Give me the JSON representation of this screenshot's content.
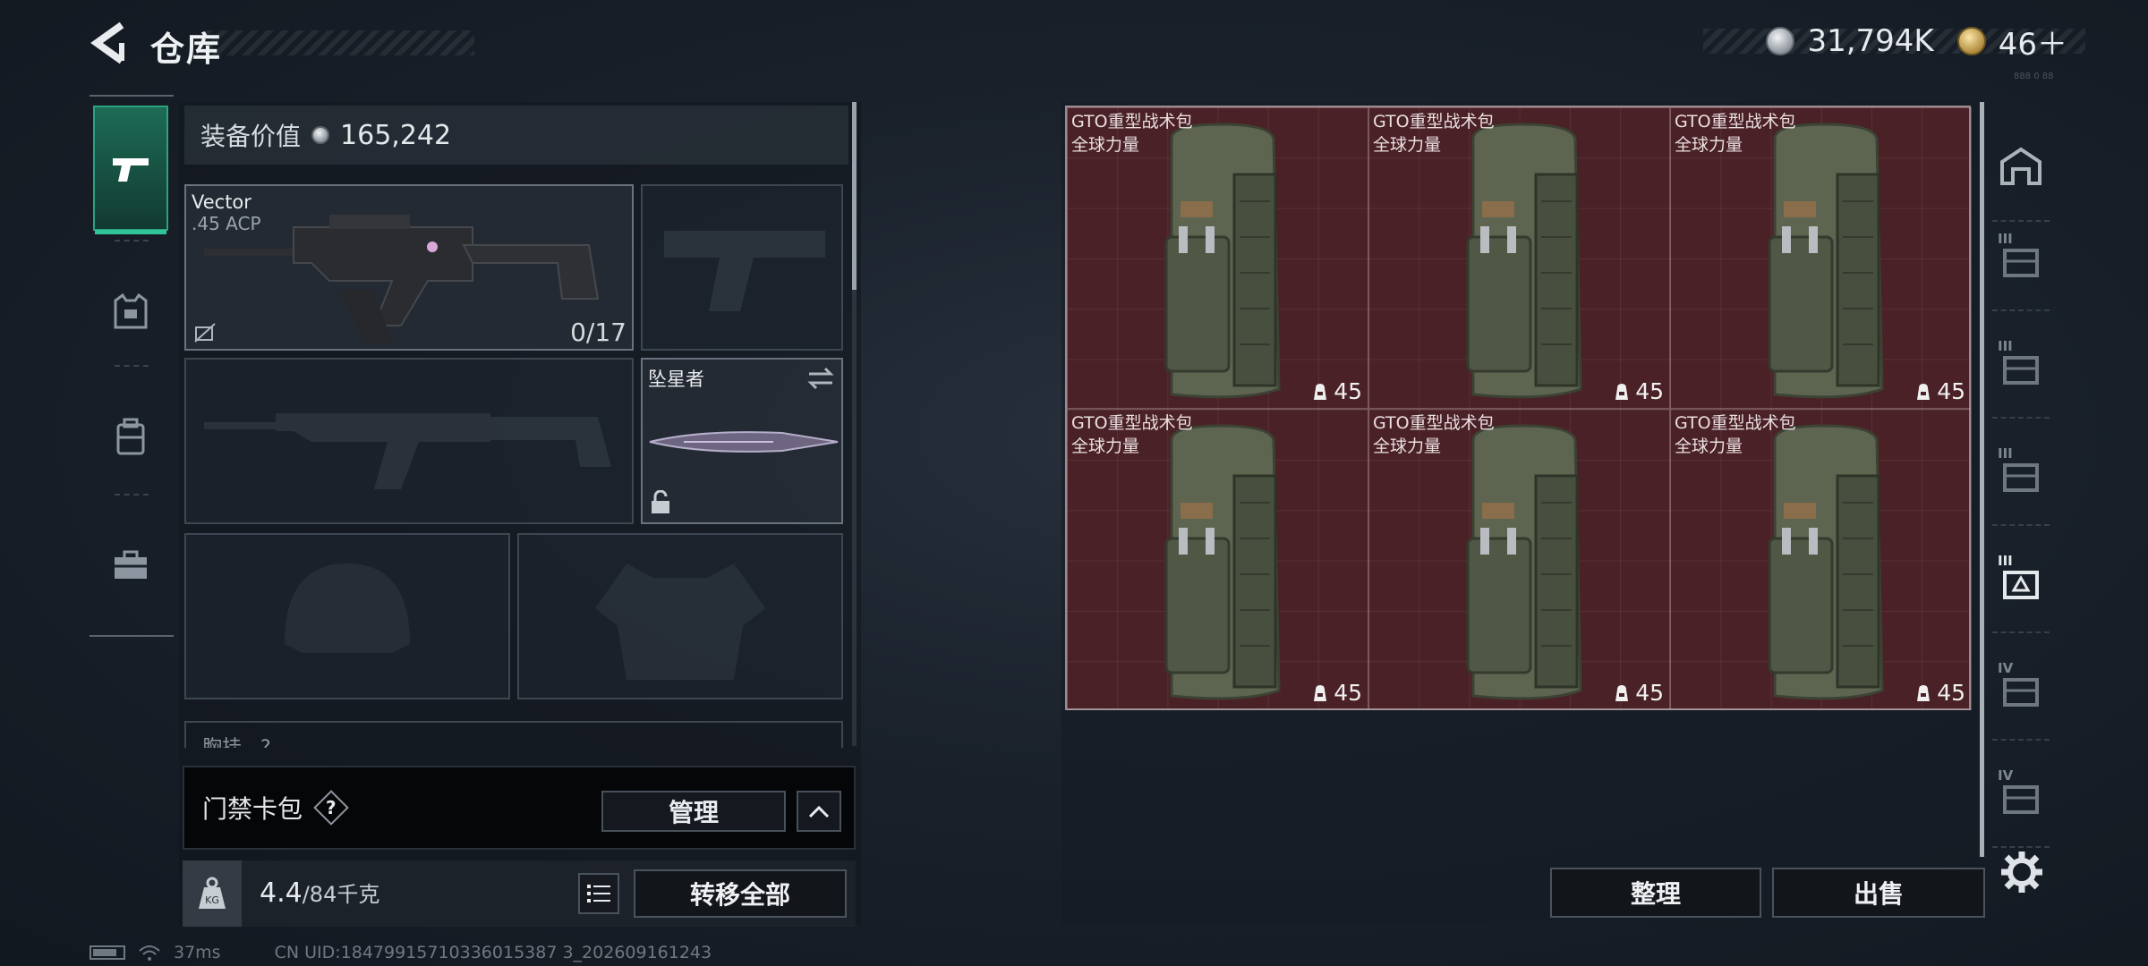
{
  "header": {
    "title": "仓库",
    "currency": {
      "silver_value": "31,794K",
      "gold_value": "46＋"
    },
    "corner_code": "888 0 88"
  },
  "equipment": {
    "value_label": "装备价值",
    "value_amount": "165,242",
    "primary": {
      "name": "Vector",
      "ammo": ".45 ACP",
      "count": "0/17"
    },
    "melee": {
      "name": "坠星者"
    },
    "chest_label": "胸挂",
    "chest_help": "?"
  },
  "keycard": {
    "label": "门禁卡包",
    "help": "?",
    "manage_label": "管理"
  },
  "capacity": {
    "current": "4.4",
    "max": "/84千克",
    "kg_label": "KG",
    "transfer_label": "转移全部"
  },
  "status": {
    "ping": "37ms",
    "uid": "CN UID:18479915710336015387 3_202609161243"
  },
  "stash": {
    "items": [
      {
        "name": "GTO重型战术包",
        "sub": "全球力量",
        "level": "45"
      },
      {
        "name": "GTO重型战术包",
        "sub": "全球力量",
        "level": "45"
      },
      {
        "name": "GTO重型战术包",
        "sub": "全球力量",
        "level": "45"
      },
      {
        "name": "GTO重型战术包",
        "sub": "全球力量",
        "level": "45"
      },
      {
        "name": "GTO重型战术包",
        "sub": "全球力量",
        "level": "45"
      },
      {
        "name": "GTO重型战术包",
        "sub": "全球力量",
        "level": "45"
      }
    ],
    "sort_label": "整理",
    "sell_label": "出售"
  },
  "right_tabs": [
    {
      "tier": ""
    },
    {
      "tier": "III"
    },
    {
      "tier": "III"
    },
    {
      "tier": "III"
    },
    {
      "tier": "III"
    },
    {
      "tier": "IV"
    },
    {
      "tier": "IV"
    }
  ]
}
